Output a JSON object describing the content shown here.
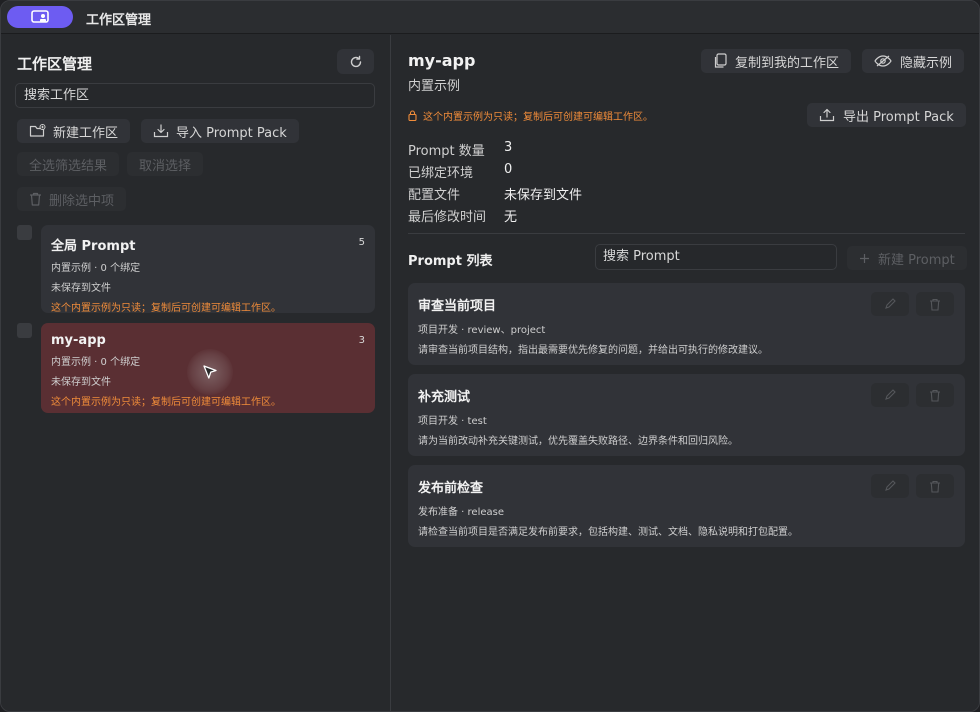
{
  "titlebar": {
    "title": "工作区管理",
    "app_icon": "workspace-app-icon"
  },
  "left": {
    "title": "工作区管理",
    "search_placeholder": "搜索工作区",
    "buttons": {
      "new_workspace": "新建工作区",
      "import_pack": "导入 Prompt Pack",
      "select_all": "全选筛选结果",
      "cancel_select": "取消选择",
      "delete_selected": "删除选中项"
    },
    "workspaces": [
      {
        "name": "全局 Prompt",
        "count": "5",
        "meta": "内置示例 · 0 个绑定",
        "file": "未保存到文件",
        "warning": "这个内置示例为只读；复制后可创建可编辑工作区。"
      },
      {
        "name": "my-app",
        "count": "3",
        "meta": "内置示例 · 0 个绑定",
        "file": "未保存到文件",
        "warning": "这个内置示例为只读；复制后可创建可编辑工作区。"
      }
    ]
  },
  "detail": {
    "title": "my-app",
    "subtitle": "内置示例",
    "copy_button": "复制到我的工作区",
    "hide_button": "隐藏示例",
    "export_button": "导出 Prompt Pack",
    "readonly_warning": "这个内置示例为只读；复制后可创建可编辑工作区。",
    "stats": [
      {
        "label": "Prompt 数量",
        "value": "3"
      },
      {
        "label": "已绑定环境",
        "value": "0"
      },
      {
        "label": "配置文件",
        "value": "未保存到文件"
      },
      {
        "label": "最后修改时间",
        "value": "无"
      }
    ],
    "list_title": "Prompt 列表",
    "prompt_search_placeholder": "搜索 Prompt",
    "new_prompt_button": "新建 Prompt",
    "prompts": [
      {
        "name": "审查当前项目",
        "tags": "项目开发 · review、project",
        "desc": "请审查当前项目结构，指出最需要优先修复的问题，并给出可执行的修改建议。"
      },
      {
        "name": "补充测试",
        "tags": "项目开发 · test",
        "desc": "请为当前改动补充关键测试，优先覆盖失败路径、边界条件和回归风险。"
      },
      {
        "name": "发布前检查",
        "tags": "发布准备 · release",
        "desc": "请检查当前项目是否满足发布前要求，包括构建、测试、文档、隐私说明和打包配置。"
      }
    ]
  },
  "colors": {
    "accent": "#6d5cf2",
    "warning": "#f08c3a",
    "active_card": "#5a2f33"
  }
}
